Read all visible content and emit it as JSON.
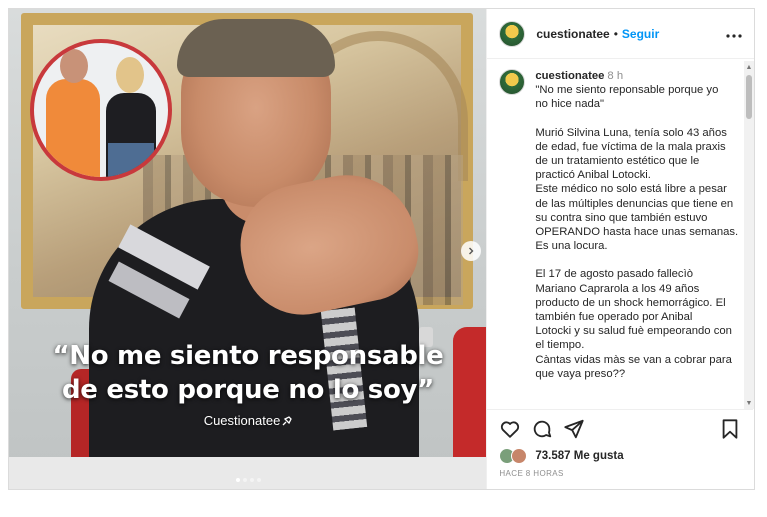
{
  "media": {
    "overlay_line1": "“No me siento responsable",
    "overlay_line2": "de esto porque no lo soy”",
    "brand_tag": "Cuestionatee",
    "slide_count": 4,
    "active_slide": 1
  },
  "header": {
    "username": "cuestionatee",
    "separator": "•",
    "follow_label": "Seguir",
    "more_icon": "more-horizontal-icon"
  },
  "caption": {
    "username": "cuestionatee",
    "time": "8 h",
    "lines": [
      "\"No me siento reponsable porque yo",
      "no hice nada\"",
      "",
      "Murió Silvina Luna, tenía solo 43 años",
      "de edad, fue víctima de la mala praxis",
      "de un tratamiento estético que le",
      "practicó Anibal Lotocki.",
      "Este médico no solo está libre a pesar",
      "de las múltiples denuncias que tiene en",
      "su contra sino que también estuvo",
      "OPERANDO hasta hace unas semanas.",
      "Es una locura.",
      "",
      "El 17 de agosto pasado fallecìò",
      "Mariano Caprarola a los 49 años",
      "producto de un shock hemorrágico. El",
      "también fue operado por Anibal",
      "Lotocki y su salud fuè empeorando con",
      "el tiempo.",
      "Càntas vidas màs se van a cobrar para",
      "que vaya preso??"
    ]
  },
  "actions": {
    "like_icon": "heart-icon",
    "comment_icon": "comment-icon",
    "share_icon": "share-icon",
    "save_icon": "bookmark-icon",
    "likes_count": "73.587",
    "likes_label": "Me gusta",
    "time_ago": "HACE 8 HORAS"
  },
  "colors": {
    "accent": "#0095f6",
    "border": "#dbdbdb",
    "inset_ring": "#c8393c"
  }
}
